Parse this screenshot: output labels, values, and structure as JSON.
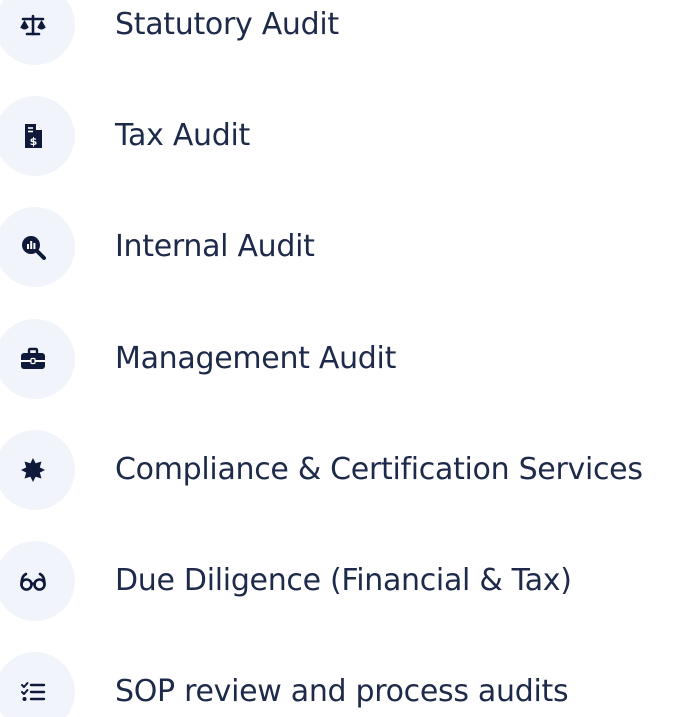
{
  "services": {
    "accent_color": "#0f1a3a",
    "label_color": "#1e2a4a",
    "circle_color": "#f1f5fb",
    "items": [
      {
        "icon": "scale-balance-icon",
        "label": "Statutory Audit"
      },
      {
        "icon": "file-invoice-dollar-icon",
        "label": "Tax Audit"
      },
      {
        "icon": "magnifier-chart-icon",
        "label": "Internal Audit"
      },
      {
        "icon": "briefcase-icon",
        "label": "Management Audit"
      },
      {
        "icon": "certificate-badge-icon",
        "label": "Compliance & Certification Services"
      },
      {
        "icon": "glasses-icon",
        "label": "Due Diligence (Financial & Tax)"
      },
      {
        "icon": "list-check-icon",
        "label": "SOP review and process audits"
      }
    ]
  }
}
